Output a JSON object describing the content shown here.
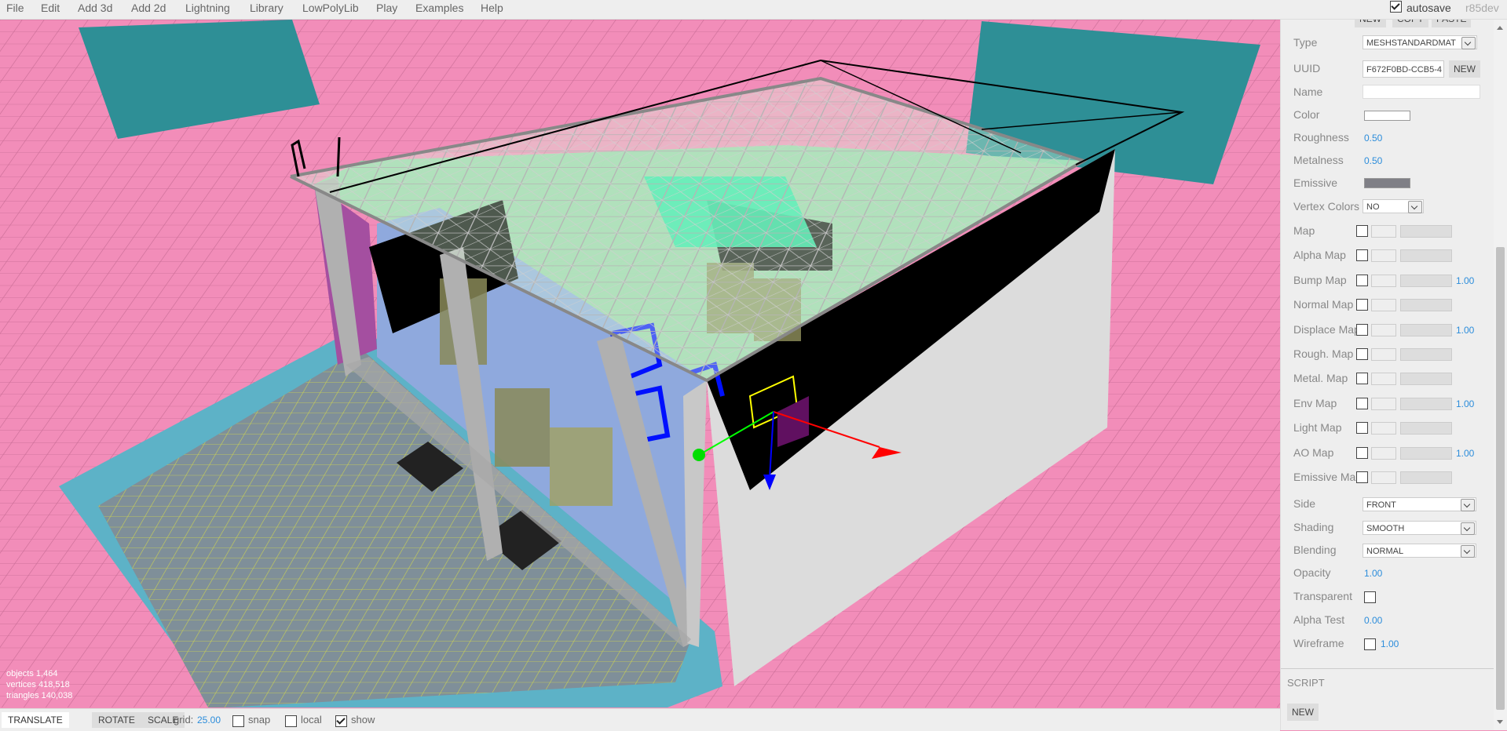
{
  "menubar": {
    "items": [
      "File",
      "Edit",
      "Add 3d",
      "Add 2d",
      "Lightning",
      "Library",
      "LowPolyLib",
      "Play",
      "Examples",
      "Help"
    ],
    "autosave_label": "autosave",
    "autosave_checked": true,
    "version": "r85dev"
  },
  "viewport": {
    "info": {
      "objects": "objects  1,464",
      "vertices": "vertices  418,518",
      "triangles": "triangles  140,038"
    }
  },
  "toolbar": {
    "translate": "TRANSLATE",
    "rotate": "ROTATE",
    "scale": "SCALE",
    "grid_label": "grid:",
    "grid_value": "25.00",
    "snap_label": "snap",
    "local_label": "local",
    "show_label": "show"
  },
  "sidebar": {
    "top_buttons": [
      "NEW",
      "COPY",
      "PASTE"
    ],
    "type_label": "Type",
    "type_value": "MESHSTANDARDMAT",
    "uuid_label": "UUID",
    "uuid_value": "F672F0BD-CCB5-4",
    "uuid_button": "NEW",
    "name_label": "Name",
    "name_value": "",
    "color_label": "Color",
    "roughness_label": "Roughness",
    "roughness_value": "0.50",
    "metalness_label": "Metalness",
    "metalness_value": "0.50",
    "emissive_label": "Emissive",
    "vertex_colors_label": "Vertex Colors",
    "vertex_colors_value": "NO",
    "maps": [
      {
        "label": "Map",
        "value": ""
      },
      {
        "label": "Alpha Map",
        "value": ""
      },
      {
        "label": "Bump Map",
        "value": "1.00"
      },
      {
        "label": "Normal Map",
        "value": ""
      },
      {
        "label": "Displace Map",
        "value": "1.00"
      },
      {
        "label": "Rough. Map",
        "value": ""
      },
      {
        "label": "Metal. Map",
        "value": ""
      },
      {
        "label": "Env Map",
        "value": "1.00"
      },
      {
        "label": "Light Map",
        "value": ""
      },
      {
        "label": "AO Map",
        "value": "1.00"
      },
      {
        "label": "Emissive Map",
        "value": ""
      }
    ],
    "side_label": "Side",
    "side_value": "FRONT",
    "shading_label": "Shading",
    "shading_value": "SMOOTH",
    "blending_label": "Blending",
    "blending_value": "NORMAL",
    "opacity_label": "Opacity",
    "opacity_value": "1.00",
    "transparent_label": "Transparent",
    "alpha_test_label": "Alpha Test",
    "alpha_test_value": "0.00",
    "wireframe_label": "Wireframe",
    "wireframe_value": "1.00",
    "script_label": "SCRIPT",
    "script_button": "NEW"
  },
  "colors": {
    "background": "#f28db9",
    "accent_number": "#2c8ddb",
    "panel": "#eeeeee"
  }
}
